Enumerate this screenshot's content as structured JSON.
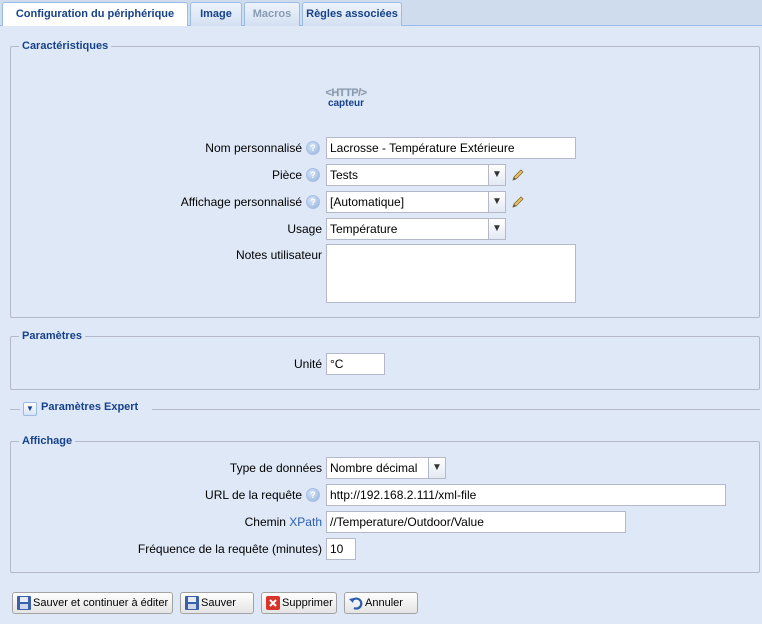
{
  "tabs": [
    {
      "label": "Configuration du périphérique",
      "state": "active"
    },
    {
      "label": "Image",
      "state": "normal"
    },
    {
      "label": "Macros",
      "state": "disabled"
    },
    {
      "label": "Règles associées",
      "state": "normal"
    }
  ],
  "characteristics": {
    "legend": "Caractéristiques",
    "device_icon_text": "<HTTP/>",
    "device_type": "capteur",
    "name_label": "Nom personnalisé",
    "name_value": "Lacrosse - Température Extérieure",
    "room_label": "Pièce",
    "room_value": "Tests",
    "display_label": "Affichage personnalisé",
    "display_value": "[Automatique]",
    "usage_label": "Usage",
    "usage_value": "Température",
    "notes_label": "Notes utilisateur",
    "notes_value": ""
  },
  "parameters": {
    "legend": "Paramètres",
    "unit_label": "Unité",
    "unit_value": "°C"
  },
  "expert": {
    "legend": "Paramètres Expert",
    "collapsed": true
  },
  "display_section": {
    "legend": "Affichage",
    "data_type_label": "Type de données",
    "data_type_value": "Nombre décimal",
    "url_label": "URL de la requête",
    "url_value": "http://192.168.2.111/xml-file",
    "xpath_label_prefix": "Chemin ",
    "xpath_label_link": "XPath",
    "xpath_value": "//Temperature/Outdoor/Value",
    "frequency_label": "Fréquence de la requête (minutes)",
    "frequency_value": "10"
  },
  "buttons": {
    "save_continue": "Sauver et continuer à éditer",
    "save": "Sauver",
    "delete": "Supprimer",
    "cancel": "Annuler"
  },
  "colors": {
    "legend": "#15428b",
    "background": "#dfe8f6",
    "border": "#99bbe8"
  }
}
